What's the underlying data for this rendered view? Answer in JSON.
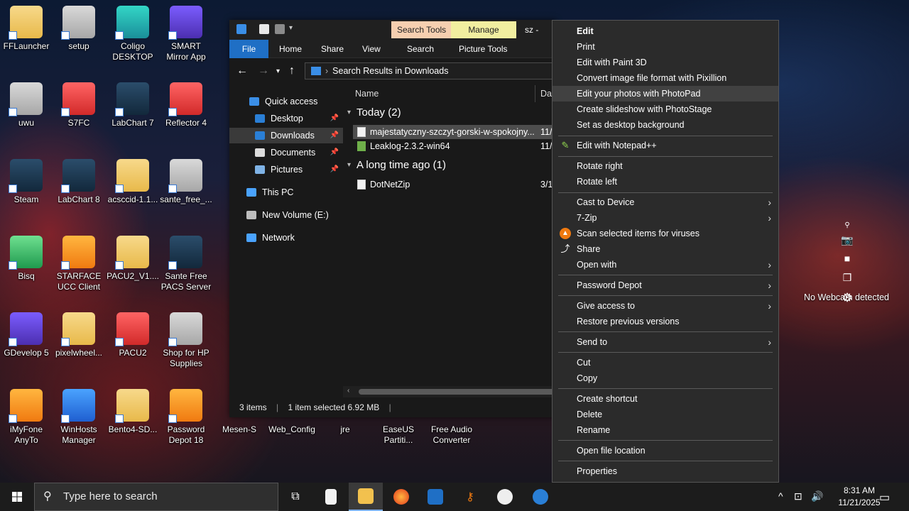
{
  "desktop_icons": [
    {
      "label": "FFLauncher",
      "style": "folder"
    },
    {
      "label": "setup",
      "style": "gray"
    },
    {
      "label": "Coligo DESKTOP",
      "style": "teal"
    },
    {
      "label": "SMART Mirror App",
      "style": "purple"
    },
    {
      "label": "uwu",
      "style": "gray"
    },
    {
      "label": "S7FC",
      "style": "red"
    },
    {
      "label": "LabChart 7",
      "style": "dark"
    },
    {
      "label": "Reflector 4",
      "style": "red"
    },
    {
      "label": "Steam",
      "style": "dark"
    },
    {
      "label": "LabChart 8",
      "style": "dark"
    },
    {
      "label": "acsccid-1.1...",
      "style": "folder"
    },
    {
      "label": "sante_free_...",
      "style": "gray"
    },
    {
      "label": "Bisq",
      "style": "green"
    },
    {
      "label": "STARFACE UCC Client",
      "style": "orange"
    },
    {
      "label": "PACU2_V1....",
      "style": "folder"
    },
    {
      "label": "Sante Free PACS Server",
      "style": "dark"
    },
    {
      "label": "GDevelop 5",
      "style": "purple"
    },
    {
      "label": "pixelwheel...",
      "style": "folder"
    },
    {
      "label": "PACU2",
      "style": "red"
    },
    {
      "label": "Shop for HP Supplies",
      "style": "gray"
    },
    {
      "label": "iMyFone AnyTo",
      "style": "orange"
    },
    {
      "label": "WinHosts Manager",
      "style": "blue"
    },
    {
      "label": "Bento4-SD...",
      "style": "folder"
    },
    {
      "label": "Password Depot 18",
      "style": "orange"
    },
    {
      "label": "Mesen-S",
      "style": "dark"
    },
    {
      "label": "Web_Config",
      "style": "gray"
    },
    {
      "label": "jre",
      "style": "folder"
    },
    {
      "label": "EaseUS Partiti...",
      "style": "blue"
    },
    {
      "label": "Free Audio Converter",
      "style": "orange"
    }
  ],
  "explorer": {
    "title": "sz - Sea",
    "ctx_tabs": {
      "search_tools": "Search Tools",
      "manage": "Manage"
    },
    "ribbon_tabs": {
      "file": "File",
      "home": "Home",
      "share": "Share",
      "view": "View",
      "search": "Search",
      "picture_tools": "Picture Tools"
    },
    "address": "Search Results in Downloads",
    "nav": {
      "quick_access": "Quick access",
      "desktop": "Desktop",
      "downloads": "Downloads",
      "documents": "Documents",
      "pictures": "Pictures",
      "this_pc": "This PC",
      "new_volume": "New Volume (E:)",
      "network": "Network"
    },
    "columns": {
      "name": "Name",
      "date": "Dat"
    },
    "groups": {
      "today": "Today (2)",
      "long_ago": "A long time ago (1)"
    },
    "files": [
      {
        "name": "majestatyczny-szczyt-gorski-w-spokojny...",
        "date": "11/"
      },
      {
        "name": "Leaklog-2.3.2-win64",
        "date": "11/"
      },
      {
        "name": "DotNetZip",
        "date": "3/1"
      }
    ],
    "status": {
      "items": "3 items",
      "selected": "1 item selected  6.92 MB"
    }
  },
  "context_menu": {
    "edit": "Edit",
    "print": "Print",
    "paint3d": "Edit with Paint 3D",
    "pixillion": "Convert image file format with Pixillion",
    "photopad": "Edit your photos with PhotoPad",
    "photostage": "Create slideshow with PhotoStage",
    "background": "Set as desktop background",
    "notepadpp": "Edit with Notepad++",
    "rotate_right": "Rotate right",
    "rotate_left": "Rotate left",
    "cast": "Cast to Device",
    "sevenzip": "7-Zip",
    "scan": "Scan selected items for viruses",
    "share": "Share",
    "open_with": "Open with",
    "password_depot": "Password Depot",
    "give_access": "Give access to",
    "restore": "Restore previous versions",
    "send_to": "Send to",
    "cut": "Cut",
    "copy": "Copy",
    "create_shortcut": "Create shortcut",
    "delete": "Delete",
    "rename": "Rename",
    "open_location": "Open file location",
    "properties": "Properties"
  },
  "webcam": {
    "text": "No Webcam detected"
  },
  "taskbar": {
    "search_placeholder": "Type here to search",
    "time": "8:31 AM",
    "date": "11/21/2025"
  }
}
